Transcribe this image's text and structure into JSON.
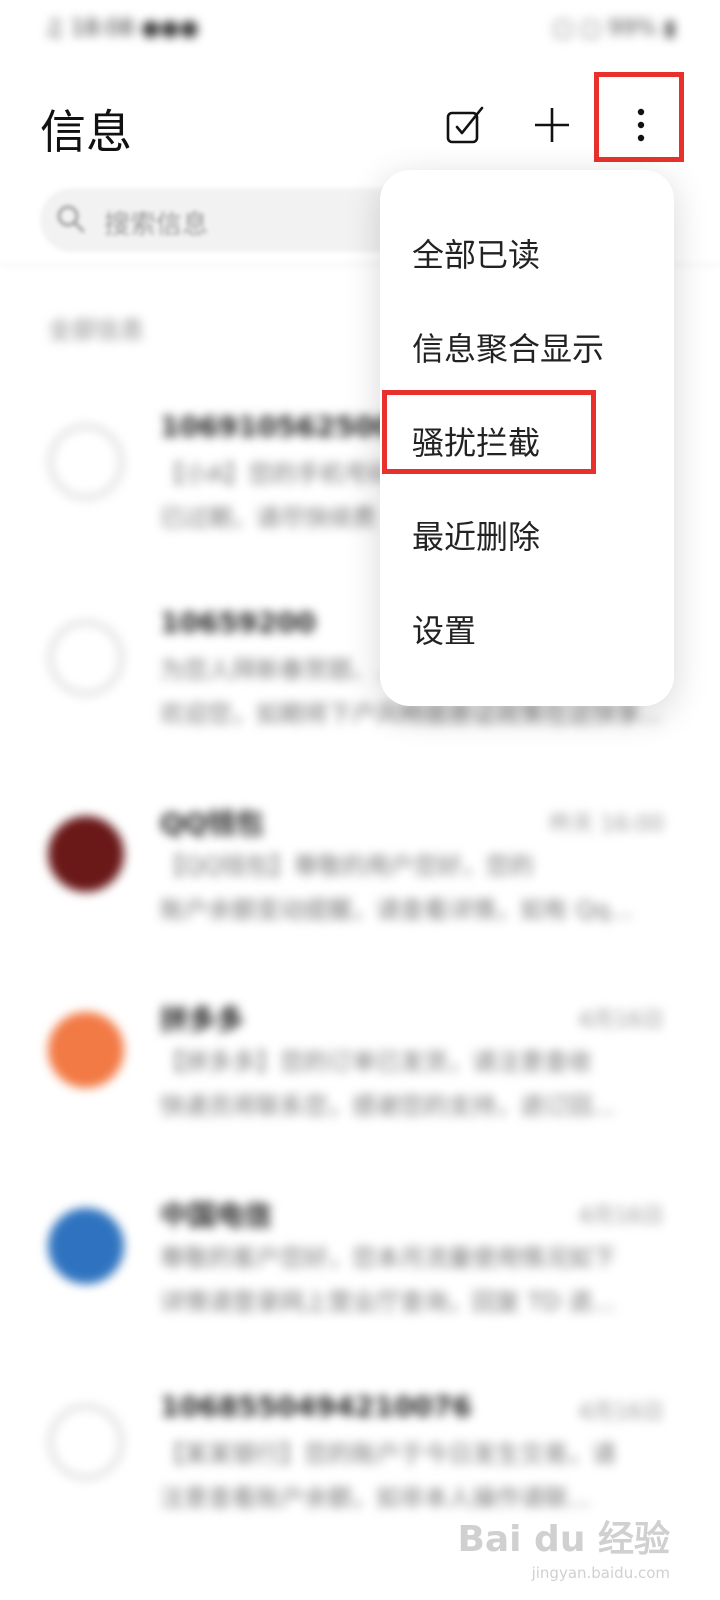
{
  "status_bar": {
    "left": "♫ 18:08 ●●●",
    "right": "▢ ▢ 99% ▮"
  },
  "header": {
    "title": "信息",
    "icons": [
      "edit-icon",
      "plus-icon",
      "more-vertical-icon"
    ]
  },
  "search": {
    "placeholder": "搜索信息"
  },
  "list": {
    "section_label": "全部信息",
    "conversations": [
      {
        "name": "106910562500",
        "time": "",
        "preview1": "【小A】您的手机号码",
        "preview2": "已过期，请尽快续费",
        "avatar_color": "#ffffff",
        "avatar_border": "#dcdcdc"
      },
      {
        "name": "10659200",
        "time": "",
        "preview1": "为您人拜新春贺题、...",
        "preview2": "欢迎您，如期将下户风畅据悬证政策在这快享...",
        "avatar_color": "#ffffff",
        "avatar_border": "#dcdcdc"
      },
      {
        "name": "QQ钱包",
        "time": "昨天 16:00",
        "preview1": "【QQ钱包】尊敬的用户您好，您的",
        "preview2": "账户余额变动提醒，请查看详情，如有 Qq...",
        "avatar_color": "#6a1818",
        "avatar_border": "#6a1818"
      },
      {
        "name": "拼多多",
        "time": "4月16日",
        "preview1": "【拼多多】您的订单已发货，请注意查收",
        "preview2": "快递员将联系您，感谢您的支持，退订回...",
        "avatar_color": "#f27a45",
        "avatar_border": "#f27a45"
      },
      {
        "name": "中国电信",
        "time": "4月16日",
        "preview1": "尊敬的客户您好，您本月流量使用情况如下",
        "preview2": "详情请登录网上营业厅查询，回复 TD 退...",
        "avatar_color": "#2f73c0",
        "avatar_border": "#2f73c0"
      },
      {
        "name": "1068550494210076",
        "time": "4月16日",
        "preview1": "【某某银行】您的账户于今日发生交易，请",
        "preview2": "注意查看账户余额，如非本人操作请联...",
        "avatar_color": "#ffffff",
        "avatar_border": "#dcdcdc"
      }
    ]
  },
  "menu": {
    "items": [
      "全部已读",
      "信息聚合显示",
      "骚扰拦截",
      "最近删除",
      "设置"
    ],
    "highlighted_index": 2
  },
  "highlight_color": "#e8312c",
  "watermark": {
    "logo": "Bai du 经验",
    "url": "jingyan.baidu.com"
  }
}
